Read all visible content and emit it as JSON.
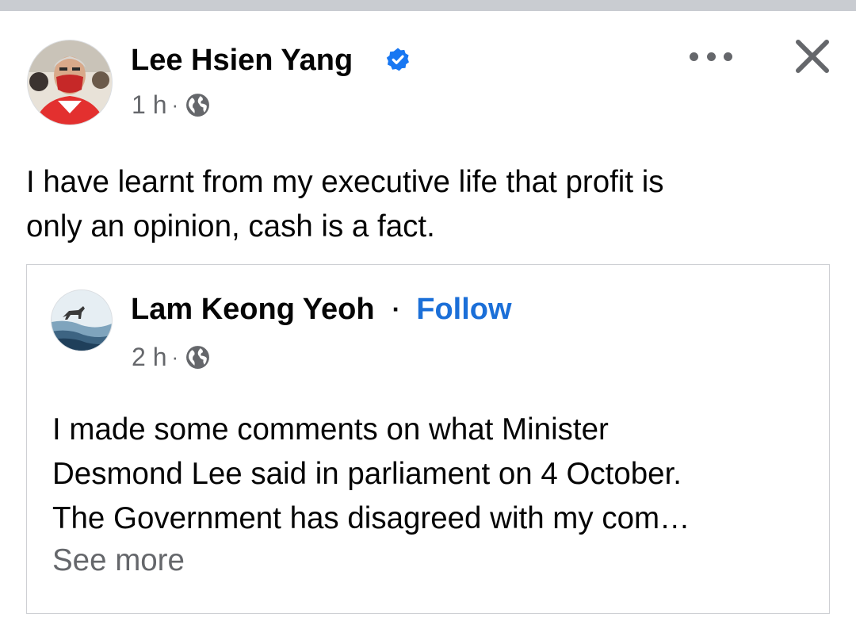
{
  "post": {
    "author": "Lee Hsien Yang",
    "verified": true,
    "time": "1 h",
    "audience_icon": "globe-icon",
    "text_lines": [
      "I have learnt from my executive life that profit is",
      "only an opinion, cash is a fact."
    ],
    "actions": {
      "more_icon": "more-options-icon",
      "close_icon": "close-icon"
    }
  },
  "shared": {
    "author": "Lam Keong Yeoh",
    "separator": "·",
    "follow_label": "Follow",
    "time": "2 h",
    "audience_icon": "globe-icon",
    "text_lines": [
      "I made some comments on what Minister",
      "Desmond Lee said in parliament on 4 October.",
      "The Government has disagreed with my com…"
    ],
    "see_more_label": "See more"
  },
  "colors": {
    "link_blue": "#1b6fd8",
    "verified_blue": "#1877f2",
    "secondary_text": "#65676b",
    "border": "#ced0d4"
  }
}
